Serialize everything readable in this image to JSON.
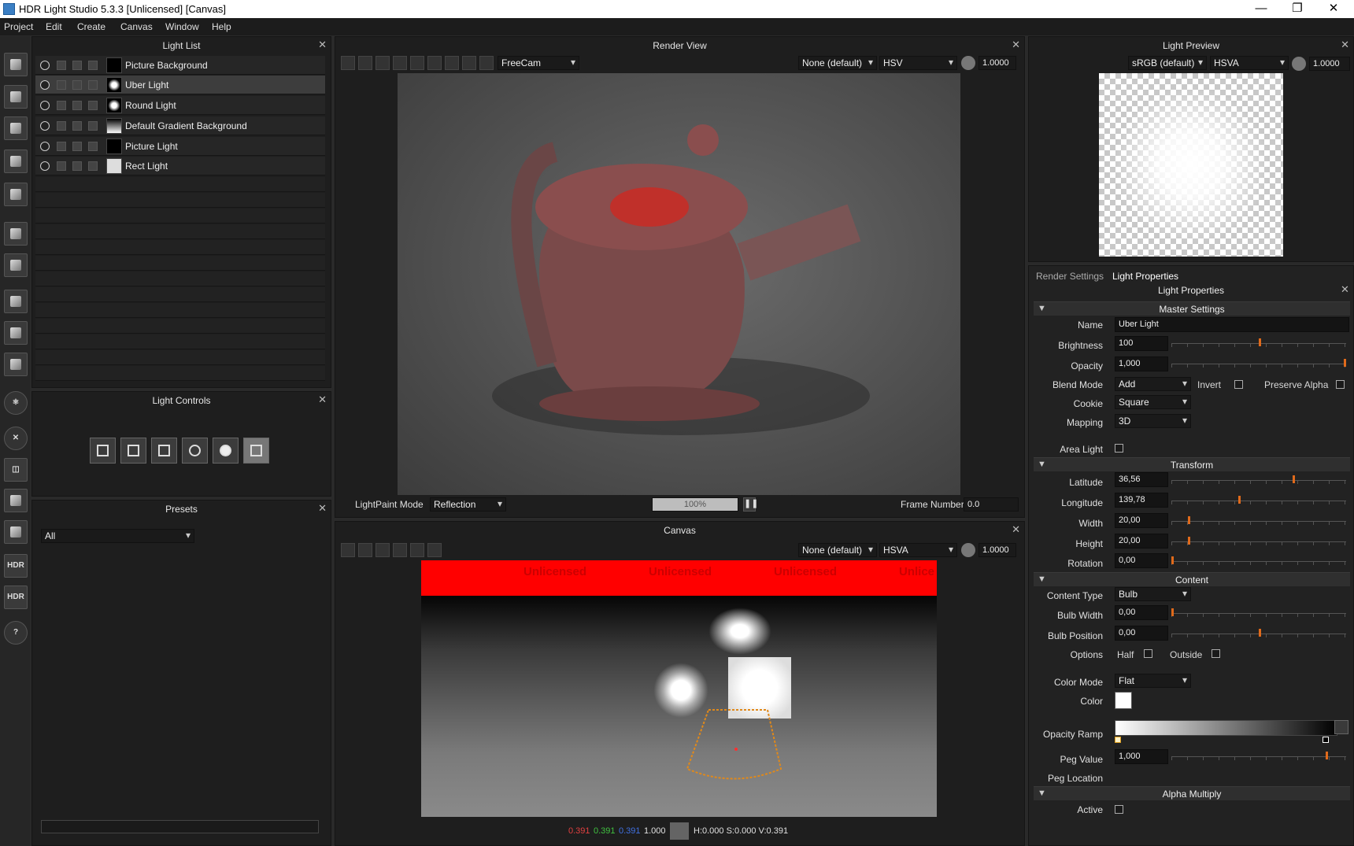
{
  "window": {
    "title": "HDR Light Studio 5.3.3 [Unlicensed] [Canvas]",
    "minimize": "—",
    "maximize": "❐",
    "close": "✕"
  },
  "menu": [
    "Project",
    "Edit",
    "Create",
    "Canvas",
    "Window",
    "Help"
  ],
  "light_list": {
    "title": "Light List",
    "items": [
      {
        "name": "Picture Background",
        "thumb": "#000000"
      },
      {
        "name": "Uber Light",
        "thumb": "radial"
      },
      {
        "name": "Round Light",
        "thumb": "radial"
      },
      {
        "name": "Default Gradient Background",
        "thumb": "gradient"
      },
      {
        "name": "Picture Light",
        "thumb": "#000000"
      },
      {
        "name": "Rect Light",
        "thumb": "#dddddd"
      }
    ],
    "selected": "Uber Light"
  },
  "light_controls": {
    "title": "Light Controls"
  },
  "presets": {
    "title": "Presets",
    "filter": "All"
  },
  "render_view": {
    "title": "Render View",
    "camera": "FreeCam",
    "color_profile": "None (default)",
    "color_mode": "HSV",
    "exposure": "1.0000",
    "lightpaint_label": "LightPaint Mode",
    "lightpaint_mode": "Reflection",
    "progress": "100%",
    "progress_value": 1.0,
    "frame_label": "Frame Number",
    "frame_value": "0.0"
  },
  "canvas": {
    "title": "Canvas",
    "color_profile": "None (default)",
    "color_mode": "HSVA",
    "exposure": "1.0000",
    "watermark": [
      "Unlicensed",
      "Unlicensed",
      "Unlicensed",
      "Unlice"
    ],
    "readout": {
      "r": "0.391",
      "g": "0.391",
      "b": "0.391",
      "a": "1.000",
      "hsv": "H:0.000 S:0.000 V:0.391"
    }
  },
  "light_preview": {
    "title": "Light Preview",
    "color_profile": "sRGB (default)",
    "color_mode": "HSVA",
    "exposure": "1.0000"
  },
  "tabs": [
    "Render Settings",
    "Light Properties"
  ],
  "light_properties": {
    "title": "Light Properties",
    "sections": {
      "master": "Master Settings",
      "transform": "Transform",
      "content": "Content",
      "alpha": "Alpha Multiply"
    },
    "name_label": "Name",
    "name": "Uber Light",
    "brightness_label": "Brightness",
    "brightness": "100",
    "opacity_label": "Opacity",
    "opacity": "1,000",
    "blend_label": "Blend Mode",
    "blend": "Add",
    "invert_label": "Invert",
    "preserve_alpha_label": "Preserve Alpha",
    "cookie_label": "Cookie",
    "cookie": "Square",
    "mapping_label": "Mapping",
    "mapping": "3D",
    "area_light_label": "Area Light",
    "latitude_label": "Latitude",
    "latitude": "36,56",
    "longitude_label": "Longitude",
    "longitude": "139,78",
    "width_label": "Width",
    "width": "20,00",
    "height_label": "Height",
    "height": "20,00",
    "rotation_label": "Rotation",
    "rotation": "0,00",
    "content_type_label": "Content Type",
    "content_type": "Bulb",
    "bulb_width_label": "Bulb Width",
    "bulb_width": "0,00",
    "bulb_position_label": "Bulb Position",
    "bulb_position": "0,00",
    "options_label": "Options",
    "half_label": "Half",
    "outside_label": "Outside",
    "color_mode_label": "Color Mode",
    "color_mode": "Flat",
    "color_label": "Color",
    "color_value": "#ffffff",
    "opacity_ramp_label": "Opacity Ramp",
    "peg_value_label": "Peg Value",
    "peg_value": "1,000",
    "peg_location_label": "Peg Location",
    "active_label": "Active"
  },
  "accent_color": "#e06a1b"
}
